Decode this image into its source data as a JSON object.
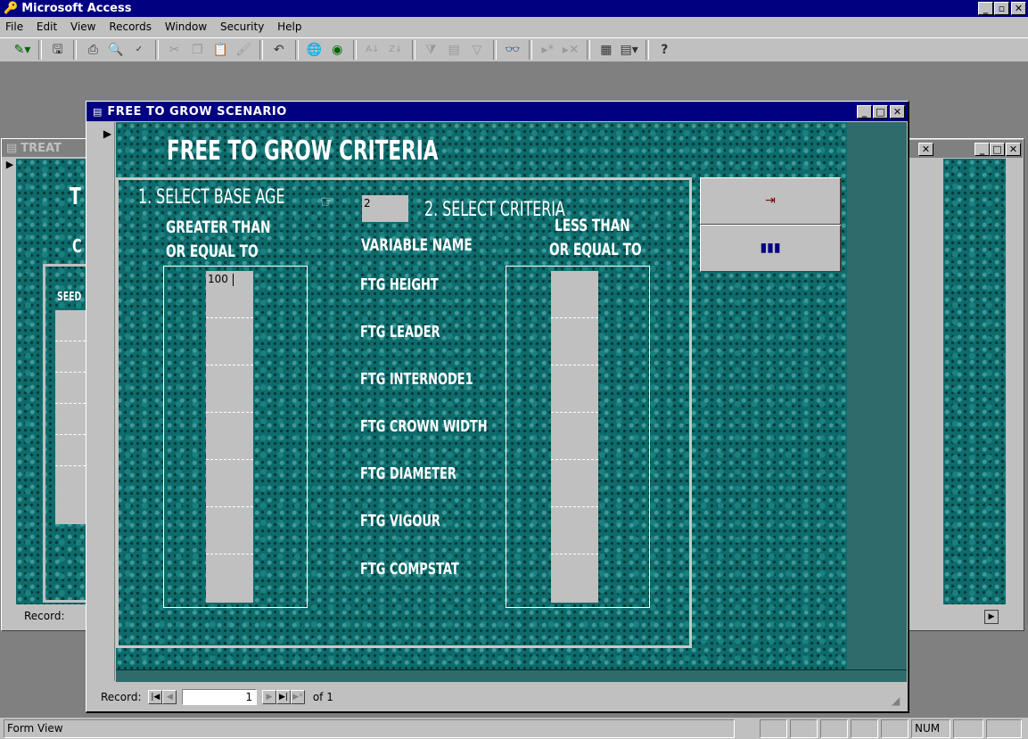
{
  "app": {
    "title": "Microsoft Access"
  },
  "menu": [
    "File",
    "Edit",
    "View",
    "Records",
    "Window",
    "Security",
    "Help"
  ],
  "background_window": {
    "title": "TREAT",
    "heading_fragment": "T",
    "sub_fragment": "C",
    "column_fragment": "SEED",
    "record_label": "Record:"
  },
  "form": {
    "title": "FREE TO GROW SCENARIO",
    "heading": "FREE TO GROW CRITERIA",
    "step1": "1. SELECT BASE AGE",
    "base_age": "2",
    "step2": "2. SELECT CRITERIA",
    "col_left_line1": "GREATER THAN",
    "col_left_line2": "OR EQUAL TO",
    "col_mid": "VARIABLE NAME",
    "col_right_line1": "LESS THAN",
    "col_right_line2": "OR EQUAL TO",
    "variables": [
      "FTG HEIGHT",
      "FTG LEADER",
      "FTG INTERNODE1",
      "FTG CROWN WIDTH",
      "FTG DIAMETER",
      "FTG VIGOUR",
      "FTG COMPSTAT"
    ],
    "greater_values": [
      "100",
      "",
      "",
      "",
      "",
      "",
      ""
    ],
    "less_values": [
      "",
      "",
      "",
      "",
      "",
      "",
      ""
    ],
    "record_label": "Record:",
    "record_number": "1",
    "record_total": "of 1"
  },
  "status": {
    "left": "Form View",
    "num": "NUM"
  },
  "colors": {
    "titlebar": "#000080",
    "pattern": "#0e6b6b"
  }
}
